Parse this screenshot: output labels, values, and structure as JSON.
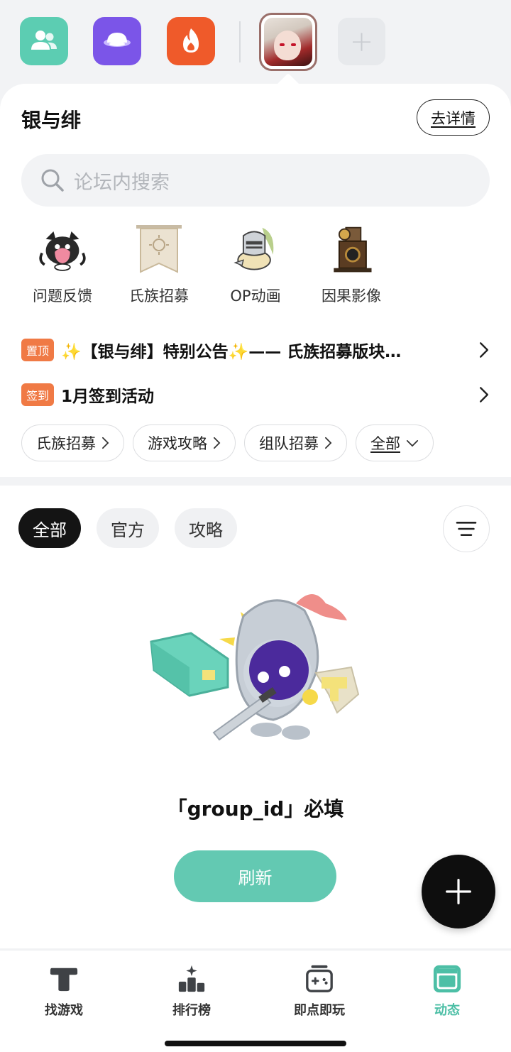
{
  "top_apps": {
    "items": [
      {
        "name": "friends",
        "color": "#5ccdb2",
        "icon": "people-icon"
      },
      {
        "name": "planet",
        "color": "#7b55e8",
        "icon": "planet-icon"
      },
      {
        "name": "fire",
        "color": "#ef5a2a",
        "icon": "fire-icon"
      },
      {
        "name": "game",
        "icon": "game-avatar"
      }
    ],
    "add_label": "+"
  },
  "forum": {
    "title": "银与绯",
    "detail_button": "去详情",
    "search_placeholder": "论坛内搜索"
  },
  "shortcuts": [
    {
      "label": "问题反馈",
      "icon": "feedback-mascot-icon"
    },
    {
      "label": "氏族招募",
      "icon": "clan-banner-icon"
    },
    {
      "label": "OP动画",
      "icon": "knight-icon"
    },
    {
      "label": "因果影像",
      "icon": "camera-icon"
    }
  ],
  "notices": [
    {
      "tag": "置顶",
      "text": "✨【银与绯】特别公告✨—— 氏族招募版块…"
    },
    {
      "tag": "签到",
      "text": "1月签到活动"
    }
  ],
  "chips": [
    {
      "label": "氏族招募"
    },
    {
      "label": "游戏攻略"
    },
    {
      "label": "组队招募"
    },
    {
      "label": "全部"
    }
  ],
  "filters": [
    {
      "label": "全部",
      "active": true
    },
    {
      "label": "官方",
      "active": false
    },
    {
      "label": "攻略",
      "active": false
    }
  ],
  "empty_state": {
    "message": "「group_id」必填",
    "refresh_label": "刷新"
  },
  "bottom_nav": [
    {
      "label": "找游戏",
      "icon": "find-games-icon",
      "active": false
    },
    {
      "label": "排行榜",
      "icon": "leaderboard-icon",
      "active": false
    },
    {
      "label": "即点即玩",
      "icon": "gamepad-icon",
      "active": false
    },
    {
      "label": "动态",
      "icon": "feed-icon",
      "active": true
    }
  ],
  "colors": {
    "accent": "#4dbfa6",
    "tag": "#f07a45",
    "refresh": "#63c9b2"
  }
}
